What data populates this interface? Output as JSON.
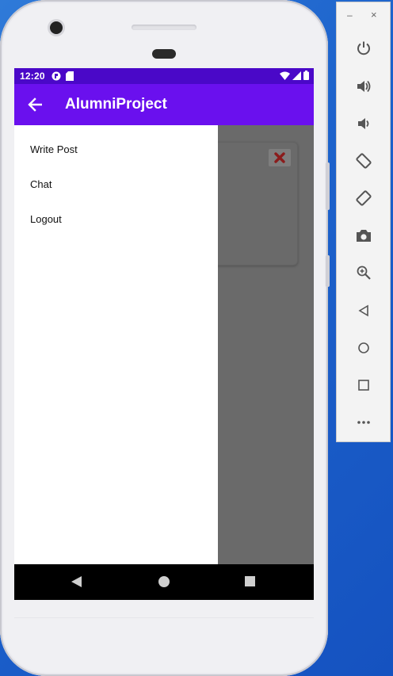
{
  "status_bar": {
    "time": "12:20"
  },
  "app_bar": {
    "title": "AlumniProject"
  },
  "drawer": {
    "items": [
      {
        "label": "Write Post"
      },
      {
        "label": "Chat"
      },
      {
        "label": "Logout"
      }
    ]
  },
  "colors": {
    "status_bar": "#4a08c8",
    "app_bar": "#6a10ee",
    "scrim": "#6a6a6a",
    "drawer": "#ffffff",
    "nav_bar": "#000000",
    "close_icon": "#8b1c1c"
  },
  "toolbar": {
    "icons": [
      "power-icon",
      "volume-up-icon",
      "volume-down-icon",
      "rotate-left-icon",
      "rotate-right-icon",
      "camera-icon",
      "zoom-icon",
      "back-icon",
      "home-icon",
      "overview-icon",
      "more-icon"
    ]
  }
}
